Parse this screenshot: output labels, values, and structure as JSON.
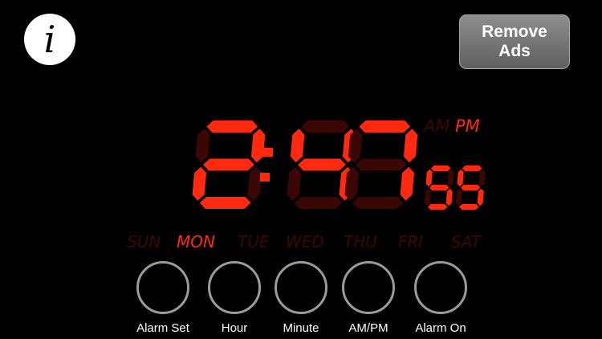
{
  "info_button": {
    "glyph": "i",
    "icon": "info-icon"
  },
  "remove_ads": {
    "label": "Remove Ads"
  },
  "clock": {
    "hour": "2",
    "minute": "47",
    "second": "55",
    "colon": ":",
    "ampm_options": [
      "AM",
      "PM"
    ],
    "ampm_active": "PM",
    "days": [
      "SUN",
      "MON",
      "TUE",
      "WED",
      "THU",
      "FRI",
      "SAT"
    ],
    "day_active": "MON"
  },
  "colors": {
    "digit_on": "#ff2a0f",
    "digit_off": "#3a0704",
    "label_off": "#3c0705"
  },
  "controls": [
    {
      "label": "Alarm Set"
    },
    {
      "label": "Hour"
    },
    {
      "label": "Minute"
    },
    {
      "label": "AM/PM"
    },
    {
      "label": "Alarm On"
    }
  ]
}
